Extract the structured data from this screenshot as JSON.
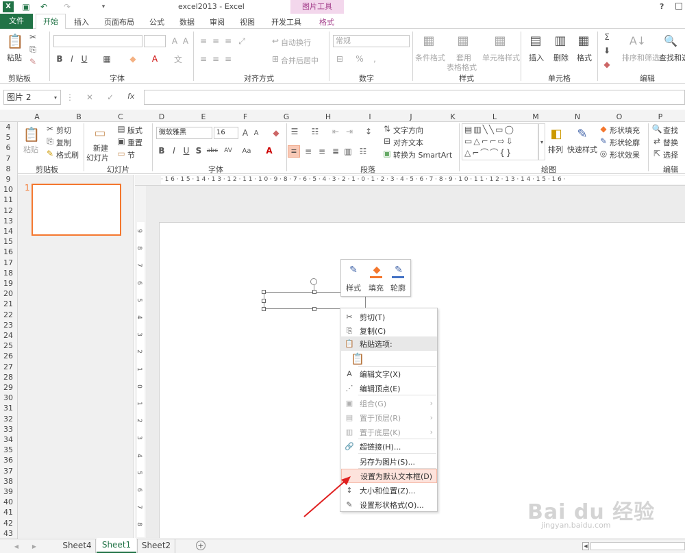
{
  "title_bar": {
    "title": "excel2013 - Excel",
    "context_tab_group": "图片工具",
    "help": "?"
  },
  "excel_tabs": [
    "文件",
    "开始",
    "插入",
    "页面布局",
    "公式",
    "数据",
    "审阅",
    "视图",
    "开发工具",
    "格式"
  ],
  "excel_ribbon": {
    "paste": "粘贴",
    "group_clipboard": "剪贴板",
    "group_font": "字体",
    "group_align": "对齐方式",
    "group_number": "数字",
    "group_styles": "样式",
    "group_cells": "单元格",
    "group_edit": "编辑",
    "wrap": "自动换行",
    "merge": "合并后居中",
    "number_format": "常规",
    "cond_format": "条件格式",
    "table_format_1": "套用",
    "table_format_2": "表格格式",
    "cell_style": "单元格样式",
    "insert": "插入",
    "delete": "删除",
    "format": "格式",
    "sort": "排序和筛选",
    "find": "查找和选"
  },
  "formula_bar": {
    "name_box": "图片 2",
    "fx": "fx"
  },
  "columns": [
    "A",
    "B",
    "C",
    "D",
    "E",
    "F",
    "G",
    "H",
    "I",
    "J",
    "K",
    "L",
    "M",
    "N",
    "O",
    "P"
  ],
  "rows": [
    "4",
    "5",
    "6",
    "7",
    "8",
    "9",
    "10",
    "11",
    "12",
    "13",
    "14",
    "15",
    "16",
    "17",
    "18",
    "19",
    "20",
    "21",
    "22",
    "23",
    "24",
    "25",
    "26",
    "27",
    "28",
    "29",
    "30",
    "31",
    "32",
    "33",
    "34",
    "35",
    "36",
    "37",
    "38",
    "39",
    "40",
    "41",
    "42",
    "43"
  ],
  "ppt_ribbon": {
    "paste": "粘贴",
    "cut": "剪切",
    "copy": "复制",
    "format_painter": "格式刷",
    "group_clipboard": "剪贴板",
    "new_slide_1": "新建",
    "new_slide_2": "幻灯片",
    "layout": "版式",
    "reset": "重置",
    "section": "节",
    "group_slides": "幻灯片",
    "font_name": "微软雅黑",
    "font_size": "16",
    "group_font": "字体",
    "text_dir": "文字方向",
    "align_text": "对齐文本",
    "smartart": "转换为 SmartArt",
    "group_para": "段落",
    "arrange": "排列",
    "quick_styles": "快速样式",
    "shape_fill": "形状填充",
    "shape_outline": "形状轮廓",
    "shape_effects": "形状效果",
    "group_draw": "绘图",
    "find": "查找",
    "replace": "替换",
    "select": "选择",
    "group_edit": "编辑"
  },
  "slide_panel": {
    "slide_number": "1"
  },
  "ruler_h": "·16·15·14·13·12·11·10·9·8·7·6·5·4·3·2·1·0·1·2·3·4·5·6·7·8·9·10·11·12·13·14·15·16·",
  "ruler_v": [
    "9",
    "8",
    "7",
    "6",
    "5",
    "4",
    "3",
    "2",
    "1",
    "0",
    "1",
    "2",
    "3",
    "4",
    "5",
    "6",
    "7",
    "8"
  ],
  "mini_toolbar": {
    "style": "样式",
    "fill": "填充",
    "outline": "轮廓"
  },
  "context_menu": [
    {
      "icon": "✂",
      "label": "剪切(T)",
      "disabled": false
    },
    {
      "icon": "⎘",
      "label": "复制(C)",
      "disabled": false
    },
    {
      "icon": "📋",
      "label": "粘贴选项:",
      "disabled": false,
      "header": true
    },
    {
      "icon": "📋",
      "label": "",
      "disabled": false,
      "paste_icon": true
    },
    {
      "icon": "A",
      "label": "编辑文字(X)",
      "disabled": false
    },
    {
      "icon": "⋰",
      "label": "编辑顶点(E)",
      "disabled": false
    },
    {
      "icon": "▣",
      "label": "组合(G)",
      "disabled": true,
      "sub": true
    },
    {
      "icon": "▤",
      "label": "置于顶层(R)",
      "disabled": true,
      "sub": true
    },
    {
      "icon": "▥",
      "label": "置于底层(K)",
      "disabled": true,
      "sub": true
    },
    {
      "icon": "🔗",
      "label": "超链接(H)...",
      "disabled": false
    },
    {
      "icon": "",
      "label": "另存为图片(S)...",
      "disabled": false
    },
    {
      "icon": "",
      "label": "设置为默认文本框(D)",
      "disabled": false,
      "highlight": true
    },
    {
      "icon": "↕",
      "label": "大小和位置(Z)...",
      "disabled": false
    },
    {
      "icon": "✎",
      "label": "设置形状格式(O)...",
      "disabled": false
    }
  ],
  "sheet_tabs": [
    "Sheet4",
    "Sheet1",
    "Sheet2"
  ],
  "active_sheet": "Sheet1",
  "watermark": {
    "text": "Bai du 经验",
    "url": "jingyan.baidu.com"
  },
  "colors": {
    "excel_green": "#217346",
    "ribbon_bg": "#ffffff",
    "tab_active": "#ffffff",
    "context_pink": "#f3d7ec",
    "accent_orange": "#f4772e",
    "menu_highlight": "#fde3dc"
  }
}
